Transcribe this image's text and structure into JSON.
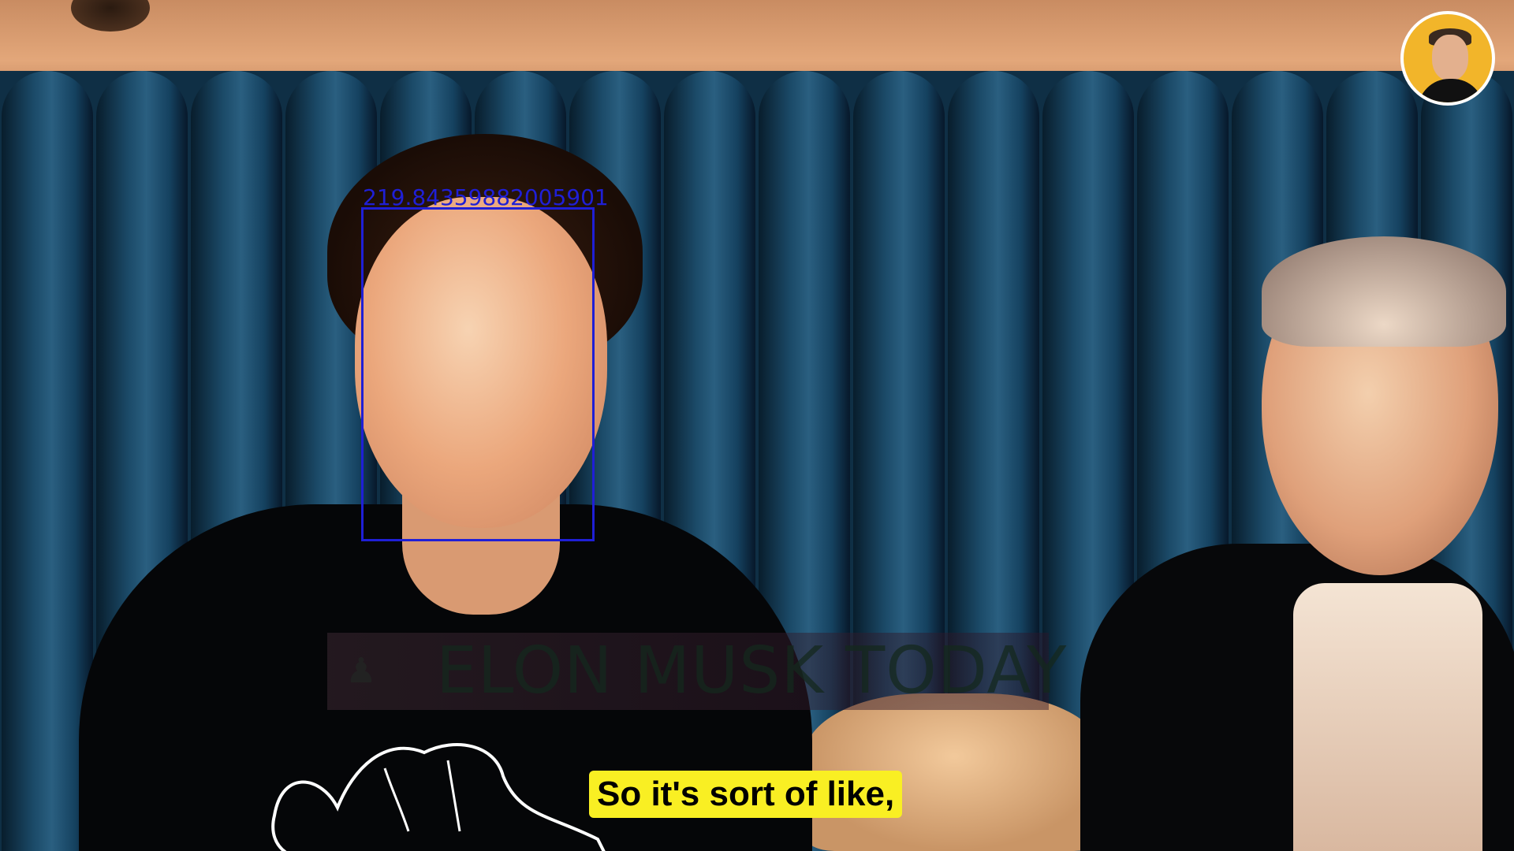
{
  "overlay": {
    "face_score": "219.84359882005901",
    "box_color": "#1f1fd6"
  },
  "watermark": {
    "text": "ELON MUSK TODAY",
    "icon": "person-icon"
  },
  "channel_logo": {
    "icon": "portrait-avatar-icon",
    "accent": "#f2b52a"
  },
  "caption": {
    "text": "So it's sort of like,",
    "background": "#f9ef23"
  },
  "doodle": {
    "icon": "cowboy-hat-icon"
  }
}
